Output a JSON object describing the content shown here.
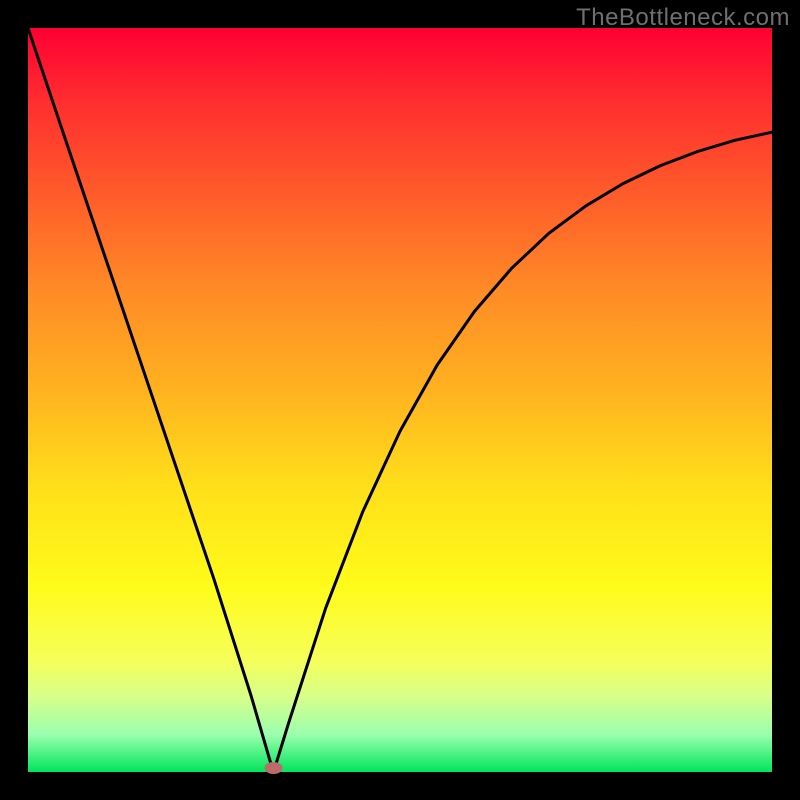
{
  "watermark": "TheBottleneck.com",
  "chart_data": {
    "type": "line",
    "title": "",
    "xlabel": "",
    "ylabel": "",
    "ylim": [
      0,
      100
    ],
    "x": [
      0,
      5,
      10,
      15,
      20,
      25,
      30,
      32.5,
      33,
      35,
      40,
      45,
      50,
      55,
      60,
      65,
      70,
      75,
      80,
      85,
      90,
      95,
      100
    ],
    "values": [
      100,
      85.1,
      70.3,
      55.5,
      40.7,
      25.9,
      10.2,
      1.6,
      0,
      6.5,
      22.0,
      35.0,
      45.8,
      54.7,
      61.9,
      67.7,
      72.4,
      76.1,
      79.1,
      81.5,
      83.4,
      84.9,
      86.0
    ],
    "marker": {
      "x": 33,
      "y": 0
    }
  },
  "colors": {
    "curve": "#000000",
    "marker_fill": "#bd6a6a",
    "background_top": "#ff0033",
    "background_bottom": "#00e55a",
    "frame": "#000000"
  }
}
